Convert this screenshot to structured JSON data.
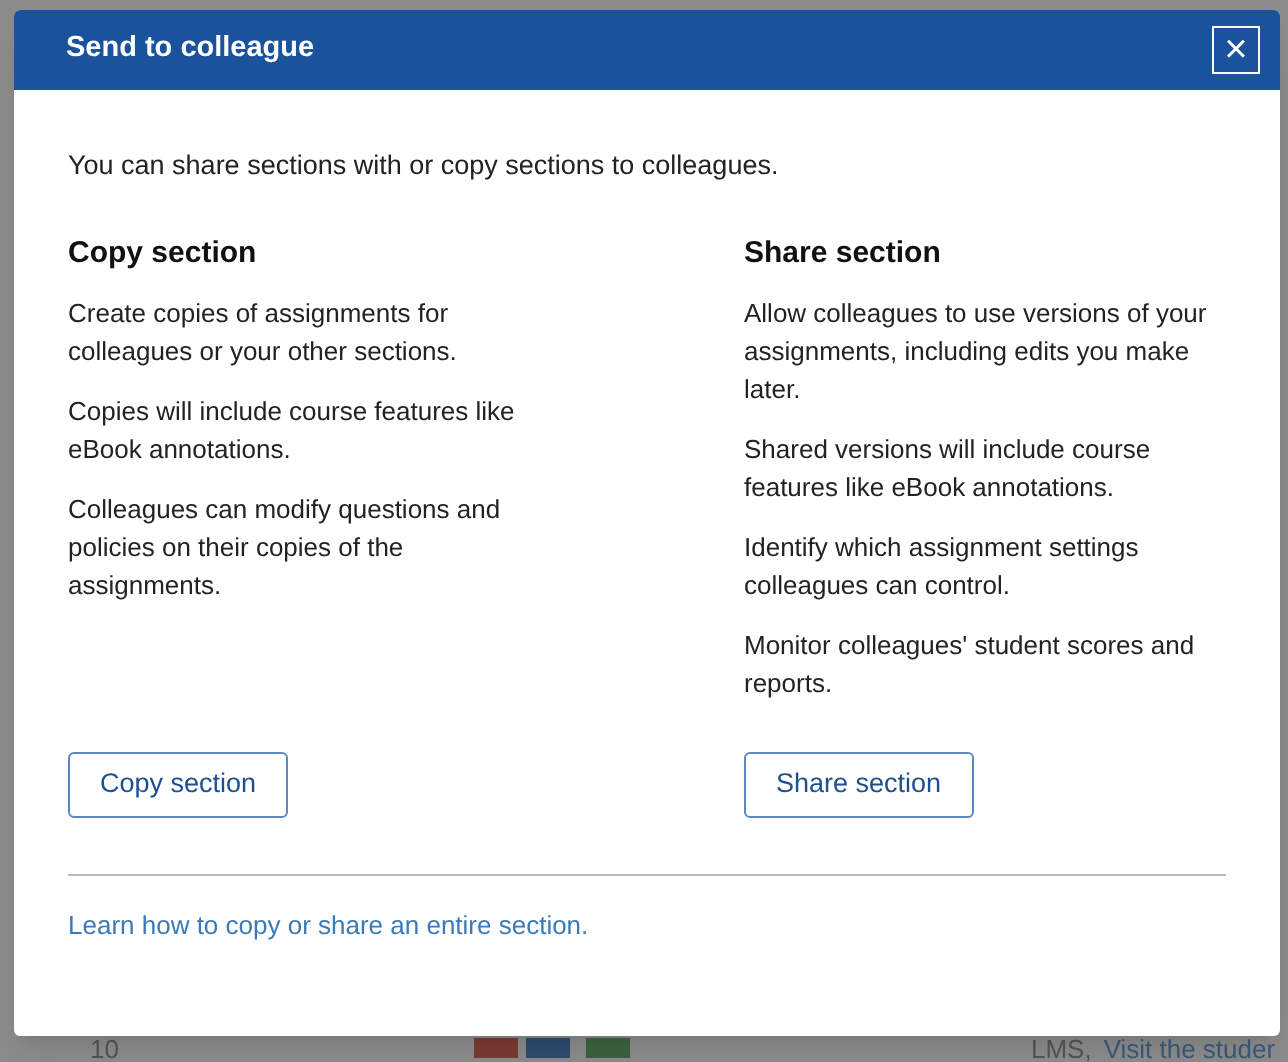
{
  "background_page": {
    "row_number": "10",
    "lms_text": "LMS,",
    "link": "Visit the studer"
  },
  "dialog": {
    "title": "Send to colleague",
    "close_icon": "×",
    "intro": "You can share sections with or copy sections to colleagues.",
    "columns": [
      {
        "heading": "Copy section",
        "paragraphs": [
          "Create copies of assignments for colleagues or your other sections.",
          "Copies will include course features like eBook annotations.",
          "Colleagues can modify questions and policies on their copies of the assignments."
        ],
        "button": "Copy section"
      },
      {
        "heading": "Share section",
        "paragraphs": [
          "Allow colleagues to use versions of your assignments, including edits you make later.",
          "Shared versions will include course features like eBook annotations.",
          "Identify which assignment settings colleagues can control.",
          "Monitor colleagues' student scores and reports."
        ],
        "button": "Share section"
      }
    ],
    "footer_link": "Learn how to copy or share an entire section."
  }
}
